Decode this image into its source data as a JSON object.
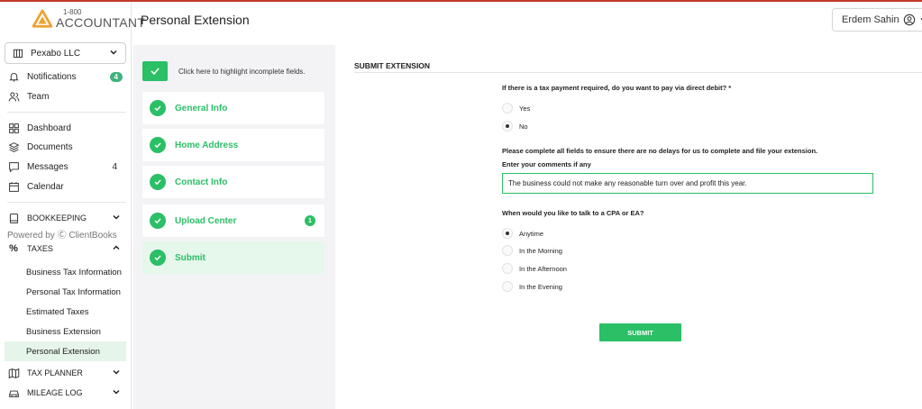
{
  "brand": {
    "small": "1-800",
    "big": "ACCOUNTANT"
  },
  "company": {
    "name": "Pexabo LLC"
  },
  "nav": {
    "notifications": {
      "label": "Notifications",
      "badge": "4"
    },
    "team": {
      "label": "Team"
    },
    "dashboard": {
      "label": "Dashboard"
    },
    "documents": {
      "label": "Documents"
    },
    "messages": {
      "label": "Messages",
      "count": "4"
    },
    "calendar": {
      "label": "Calendar"
    },
    "bookkeeping": {
      "label": "BOOKKEEPING"
    },
    "powered_by": "Powered by Ⓒ ClientBooks",
    "taxes": {
      "label": "TAXES"
    },
    "taxes_items": [
      "Business Tax Information",
      "Personal Tax Information",
      "Estimated Taxes",
      "Business Extension",
      "Personal Extension"
    ],
    "tax_planner": {
      "label": "TAX PLANNER"
    },
    "mileage_log": {
      "label": "MILEAGE LOG"
    }
  },
  "header": {
    "title": "Personal Extension",
    "user": "Erdem Sahin"
  },
  "steps": {
    "highlight_text": "Click here to highlight incomplete fields.",
    "items": [
      {
        "label": "General Info"
      },
      {
        "label": "Home Address"
      },
      {
        "label": "Contact Info"
      },
      {
        "label": "Upload Center",
        "badge": "1"
      },
      {
        "label": "Submit"
      }
    ]
  },
  "form": {
    "heading": "SUBMIT EXTENSION",
    "q_debit": "If there is a tax payment required, do you want to pay via direct debit? *",
    "debit_options": [
      "Yes",
      "No"
    ],
    "debit_selected": "No",
    "notice": "Please complete all fields to ensure there are no delays for us to complete and file your extension.",
    "comments_label": "Enter your comments if any",
    "comments_value": "The business could not make any reasonable turn over and profit this year.",
    "q_talk": "When would you like to talk to a CPA or EA?",
    "talk_options": [
      "Anytime",
      "In the Morning",
      "In the Afternoon",
      "In the Evening"
    ],
    "talk_selected": "Anytime",
    "submit_label": "SUBMIT"
  },
  "colors": {
    "accent": "#2bbf66",
    "badge": "#3fb37f",
    "logo": "#f0a030"
  }
}
